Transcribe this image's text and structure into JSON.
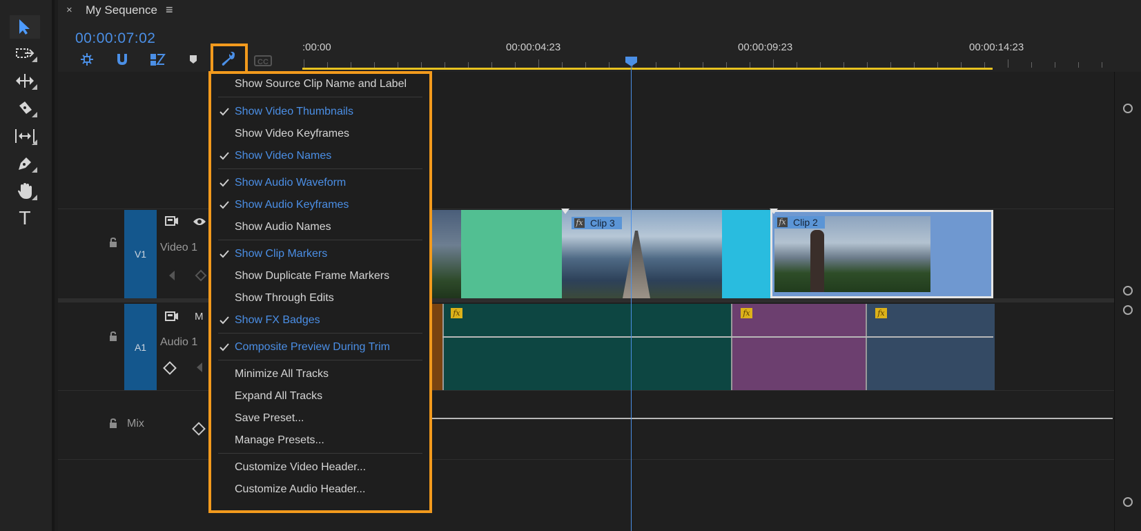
{
  "panel": {
    "tab_close": "×",
    "tab_title": "My Sequence",
    "tab_menu": "≡"
  },
  "timecode": "00:00:07:02",
  "ruler": {
    "labels": [
      ":00:00",
      "00:00:04:23",
      "00:00:09:23",
      "00:00:14:23"
    ]
  },
  "tools": [
    {
      "name": "selection-tool-icon"
    },
    {
      "name": "track-select-forward-tool-icon"
    },
    {
      "name": "ripple-edit-tool-icon"
    },
    {
      "name": "razor-tool-icon"
    },
    {
      "name": "slip-tool-icon"
    },
    {
      "name": "pen-tool-icon"
    },
    {
      "name": "hand-tool-icon"
    },
    {
      "name": "type-tool-icon",
      "label": "T"
    }
  ],
  "timeline_controls": {
    "nest_icon": "insert-nest-icon",
    "snap_icon": "snap-magnet-icon",
    "linked_icon": "linked-selection-icon",
    "marker_icon": "add-marker-icon",
    "settings_icon": "wrench-icon",
    "captions_label": "CC"
  },
  "menu": {
    "items": [
      {
        "label": "Show Source Clip Name and Label",
        "checked": false
      },
      {
        "label": "Show Video Thumbnails",
        "checked": true
      },
      {
        "label": "Show Video Keyframes",
        "checked": false
      },
      {
        "label": "Show Video Names",
        "checked": true
      },
      {
        "label": "Show Audio Waveform",
        "checked": true
      },
      {
        "label": "Show Audio Keyframes",
        "checked": true
      },
      {
        "label": "Show Audio Names",
        "checked": false
      },
      {
        "label": "Show Clip Markers",
        "checked": true
      },
      {
        "label": "Show Duplicate Frame Markers",
        "checked": false
      },
      {
        "label": "Show Through Edits",
        "checked": false
      },
      {
        "label": "Show FX Badges",
        "checked": true
      },
      {
        "label": "Composite Preview During Trim",
        "checked": true
      },
      {
        "label": "Minimize All Tracks",
        "checked": false
      },
      {
        "label": "Expand All Tracks",
        "checked": false
      },
      {
        "label": "Save Preset...",
        "checked": false
      },
      {
        "label": "Manage Presets...",
        "checked": false
      },
      {
        "label": "Customize Video Header...",
        "checked": false
      },
      {
        "label": "Customize Audio Header...",
        "checked": false
      }
    ]
  },
  "tracks": {
    "video": {
      "id": "V1",
      "name": "Video 1",
      "toggle_output_icon": "eye-icon",
      "sync_icon": "film-sync-icon"
    },
    "audio": {
      "id": "A1",
      "name": "Audio 1",
      "mute": "M",
      "sync_icon": "film-sync-icon"
    },
    "mix": {
      "name": "Mix"
    }
  },
  "clips": {
    "video": [
      {
        "label": "Clip 3",
        "fx": "fx",
        "color": "#5a9ed8"
      },
      {
        "label": "Clip 2",
        "fx": "fx",
        "color": "#6f98d0"
      }
    ],
    "transitions": [
      "#52bf92",
      "#29bcdf"
    ],
    "audio": [
      {
        "color": "#0d4642",
        "fx": "fx"
      },
      {
        "color": "#6c3f6f",
        "fx": "fx"
      },
      {
        "color": "#344a64",
        "fx": "fx"
      }
    ]
  },
  "colors": {
    "accent": "#4b8fe6",
    "highlight": "#f29a1d",
    "track_label": "#14578d",
    "work_area": "#e8c21f"
  }
}
